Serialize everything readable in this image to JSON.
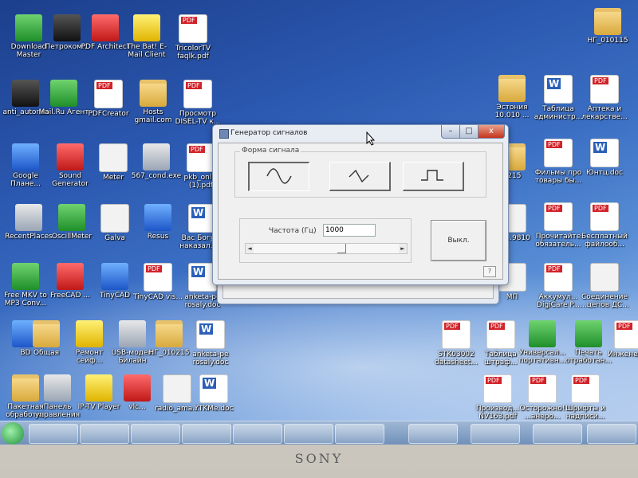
{
  "desktop": {
    "icons": [
      {
        "id": "download-master",
        "label": "Download Master",
        "glyph": "g-green"
      },
      {
        "id": "petrokom",
        "label": "Петроком...",
        "glyph": "g-dark"
      },
      {
        "id": "pdf-architect",
        "label": "PDF Architect",
        "glyph": "g-red"
      },
      {
        "id": "the-bat",
        "label": "The Bat! E-Mail Client",
        "glyph": "g-yellow"
      },
      {
        "id": "tricolortv",
        "label": "TricolorTV faqlk.pdf",
        "glyph": "g-pdf"
      },
      {
        "id": "ng-010115",
        "label": "НГ_010115",
        "glyph": "g-folder"
      },
      {
        "id": "anti-autorun",
        "label": "anti_autorun",
        "glyph": "g-dark"
      },
      {
        "id": "mailru",
        "label": "Mail.Ru Агент",
        "glyph": "g-green"
      },
      {
        "id": "pdfcreator",
        "label": "PDFCreator",
        "glyph": "g-pdf"
      },
      {
        "id": "hosts",
        "label": "Hosts gmail.com",
        "glyph": "g-folder"
      },
      {
        "id": "prosmotr",
        "label": "Просмотр DISEL-TV к...",
        "glyph": "g-pdf"
      },
      {
        "id": "estonia",
        "label": "Эстония 10.010 ...",
        "glyph": "g-folder"
      },
      {
        "id": "tablica",
        "label": "Таблица администр...",
        "glyph": "g-word"
      },
      {
        "id": "apteka",
        "label": "Аптека и лекарстве...",
        "glyph": "g-pdf"
      },
      {
        "id": "google-planet",
        "label": "Google Плане...",
        "glyph": "g-blue"
      },
      {
        "id": "sound-generator",
        "label": "Sound Generator",
        "glyph": "g-red"
      },
      {
        "id": "meter",
        "label": "Meter",
        "glyph": "g-white"
      },
      {
        "id": "cond",
        "label": "567_cond.exe",
        "glyph": "g-app"
      },
      {
        "id": "pkb-online",
        "label": "pkb_onlin (1).pdf",
        "glyph": "g-pdf"
      },
      {
        "id": "n0215",
        "label": "0215",
        "glyph": "g-folder"
      },
      {
        "id": "filmy",
        "label": "Фильмы про товары бы...",
        "glyph": "g-pdf"
      },
      {
        "id": "yunts",
        "label": "Юнтц.doc",
        "glyph": "g-word"
      },
      {
        "id": "recent-places",
        "label": "RecentPlaces",
        "glyph": "g-app"
      },
      {
        "id": "oscillmeter",
        "label": "OscillMeter",
        "glyph": "g-green"
      },
      {
        "id": "galva",
        "label": "Galva",
        "glyph": "g-white"
      },
      {
        "id": "resus",
        "label": "Resus",
        "glyph": "g-blue"
      },
      {
        "id": "vas-bogu",
        "label": "Вас Богу ... наказал.doc",
        "glyph": "g-word"
      },
      {
        "id": "n9810",
        "label": "на ...9810",
        "glyph": "g-white"
      },
      {
        "id": "prochitaite",
        "label": "Прочитайте обязатель...",
        "glyph": "g-pdf"
      },
      {
        "id": "besplatny",
        "label": "Бесплатный файлооб...",
        "glyph": "g-pdf"
      },
      {
        "id": "free-mkv",
        "label": "Free MKV to MP3 Conv...",
        "glyph": "g-green"
      },
      {
        "id": "freecad",
        "label": "FreeCAD ...",
        "glyph": "g-red"
      },
      {
        "id": "tinycad",
        "label": "TinyCAD",
        "glyph": "g-blue"
      },
      {
        "id": "tinycad-vis",
        "label": "TinyCAD vis...",
        "glyph": "g-pdf"
      },
      {
        "id": "anketa",
        "label": "anketa-pe rosaly.doc",
        "glyph": "g-word"
      },
      {
        "id": "mp",
        "label": "МП",
        "glyph": "g-white"
      },
      {
        "id": "akkumul",
        "label": "Аккумул... DigiCare P...",
        "glyph": "g-pdf"
      },
      {
        "id": "soedinenie",
        "label": "Соединение ...цепов ДС...",
        "glyph": "g-white"
      },
      {
        "id": "bd",
        "label": "BD",
        "glyph": "g-blue"
      },
      {
        "id": "obshaya",
        "label": "Общая",
        "glyph": "g-folder"
      },
      {
        "id": "remont",
        "label": "Ремонт сейф...",
        "glyph": "g-yellow"
      },
      {
        "id": "usb-modem",
        "label": "USB-модем Билайн",
        "glyph": "g-app"
      },
      {
        "id": "ng-010215",
        "label": "НГ_010215",
        "glyph": "g-folder"
      },
      {
        "id": "anketa-2",
        "label": "anketa-pe rosaly.doc",
        "glyph": "g-word"
      },
      {
        "id": "stk",
        "label": "STK03002 datasheet...",
        "glyph": "g-pdf"
      },
      {
        "id": "tablica-2",
        "label": "Таблица штраф...",
        "glyph": "g-pdf"
      },
      {
        "id": "universal",
        "label": "Универсал... портативн...",
        "glyph": "g-green"
      },
      {
        "id": "pechat",
        "label": "Печать отработан...",
        "glyph": "g-green"
      },
      {
        "id": "inzhener",
        "label": "Инженер...",
        "glyph": "g-pdf"
      },
      {
        "id": "paketnaya",
        "label": "Пакетная обработка",
        "glyph": "g-folder"
      },
      {
        "id": "panel-upr",
        "label": "Панель управления",
        "glyph": "g-app"
      },
      {
        "id": "iptv",
        "label": "IP-TV Player",
        "glyph": "g-yellow"
      },
      {
        "id": "vlc",
        "label": "vlc...",
        "glyph": "g-red"
      },
      {
        "id": "radio",
        "label": "radio_ama...",
        "glyph": "g-white"
      },
      {
        "id": "ytkme",
        "label": "YTKMe.doc",
        "glyph": "g-word"
      },
      {
        "id": "proizvod",
        "label": "Производ... NV163.pdf",
        "glyph": "g-pdf"
      },
      {
        "id": "ostorozhno",
        "label": "Осторожно! ...анеро...",
        "glyph": "g-pdf"
      },
      {
        "id": "shrifty",
        "label": "Шрифты и надписи...",
        "glyph": "g-pdf"
      }
    ]
  },
  "dialog": {
    "title": "Генератор сигналов",
    "min_label": "–",
    "max_label": "□",
    "close_label": "x",
    "waveform_group_label": "Форма сигнала",
    "frequency_label": "Частота (Гц)",
    "frequency_value": "1000",
    "off_button_label": "Выкл.",
    "help_label": "?"
  },
  "background_window": {
    "help_label": "?"
  },
  "footer": {
    "brand": "SONY"
  }
}
